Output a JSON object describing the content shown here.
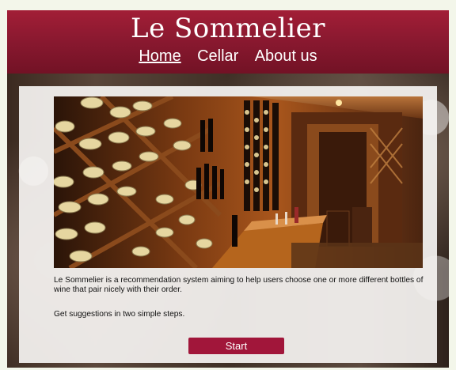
{
  "header": {
    "title": "Le Sommelier",
    "nav": [
      "Home",
      "Cellar",
      "About us"
    ],
    "active_nav": "Home"
  },
  "main": {
    "description": "Le Sommelier is a recommendation system aiming to help users choose one or more different bottles of wine that pair nicely with their order.",
    "steps_text": "Get suggestions in two simple steps.",
    "start_label": "Start"
  },
  "colors": {
    "brand": "#8b1930",
    "button": "#a1163a"
  }
}
